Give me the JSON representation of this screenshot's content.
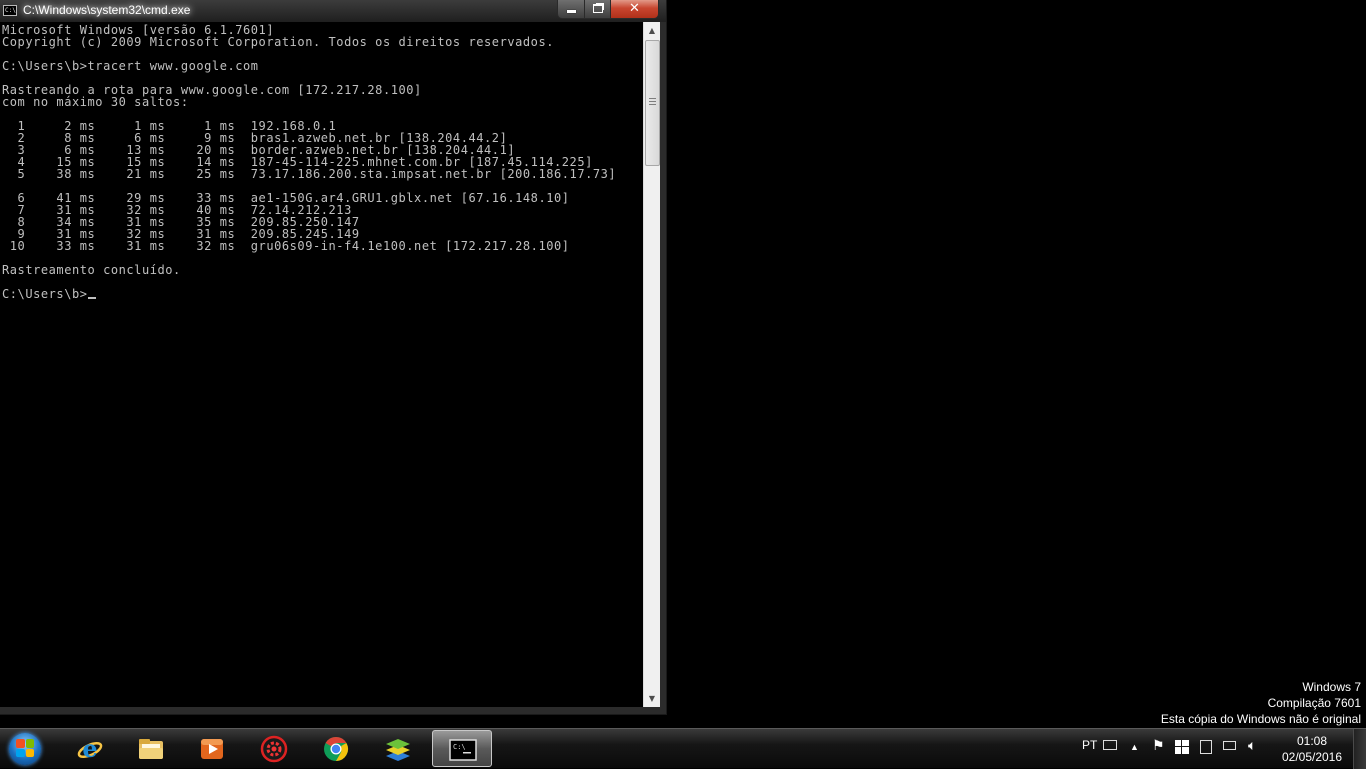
{
  "window": {
    "title": "C:\\Windows\\system32\\cmd.exe",
    "icon": "cmd-icon",
    "minimize_icon": "minimize-icon",
    "maximize_icon": "maximize-icon",
    "close_icon": "close-icon"
  },
  "console": {
    "lines": [
      "Microsoft Windows [versão 6.1.7601]",
      "Copyright (c) 2009 Microsoft Corporation. Todos os direitos reservados.",
      "",
      "C:\\Users\\b>tracert www.google.com",
      "",
      "Rastreando a rota para www.google.com [172.217.28.100]",
      "com no máximo 30 saltos:",
      "",
      "  1     2 ms     1 ms     1 ms  192.168.0.1",
      "  2     8 ms     6 ms     9 ms  bras1.azweb.net.br [138.204.44.2]",
      "  3     6 ms    13 ms    20 ms  border.azweb.net.br [138.204.44.1]",
      "  4    15 ms    15 ms    14 ms  187-45-114-225.mhnet.com.br [187.45.114.225]",
      "  5    38 ms    21 ms    25 ms  73.17.186.200.sta.impsat.net.br [200.186.17.73]",
      "",
      "  6    41 ms    29 ms    33 ms  ae1-150G.ar4.GRU1.gblx.net [67.16.148.10]",
      "  7    31 ms    32 ms    40 ms  72.14.212.213",
      "  8    34 ms    31 ms    35 ms  209.85.250.147",
      "  9    31 ms    32 ms    31 ms  209.85.245.149",
      " 10    33 ms    31 ms    32 ms  gru06s09-in-f4.1e100.net [172.217.28.100]",
      "",
      "Rastreamento concluído.",
      ""
    ],
    "prompt": "C:\\Users\\b>",
    "text_color": "#c0c0c0",
    "background": "#000000"
  },
  "scrollbar": {
    "up_icon": "scroll-up-arrow-icon",
    "down_icon": "scroll-down-arrow-icon"
  },
  "watermark": {
    "line1": "Windows 7",
    "line2": "Compilação 7601",
    "line3": "Esta cópia do Windows não é original"
  },
  "taskbar": {
    "start_icon": "windows-start-orb-icon",
    "pinned": [
      {
        "name": "internet-explorer-icon"
      },
      {
        "name": "windows-explorer-icon"
      },
      {
        "name": "media-player-icon"
      },
      {
        "name": "red-gear-app-icon"
      },
      {
        "name": "chrome-icon"
      },
      {
        "name": "bluestacks-icon"
      },
      {
        "name": "cmd-icon"
      }
    ],
    "tray": {
      "language": "PT",
      "clock_time": "01:08",
      "clock_date": "02/05/2016"
    }
  },
  "colors": {
    "close_button": "#c8462f",
    "ie_blue": "#1e8ad6",
    "chrome_red": "#db4437",
    "chrome_yellow": "#f4c20d",
    "chrome_green": "#0f9d58",
    "chrome_blue": "#4285f4"
  }
}
